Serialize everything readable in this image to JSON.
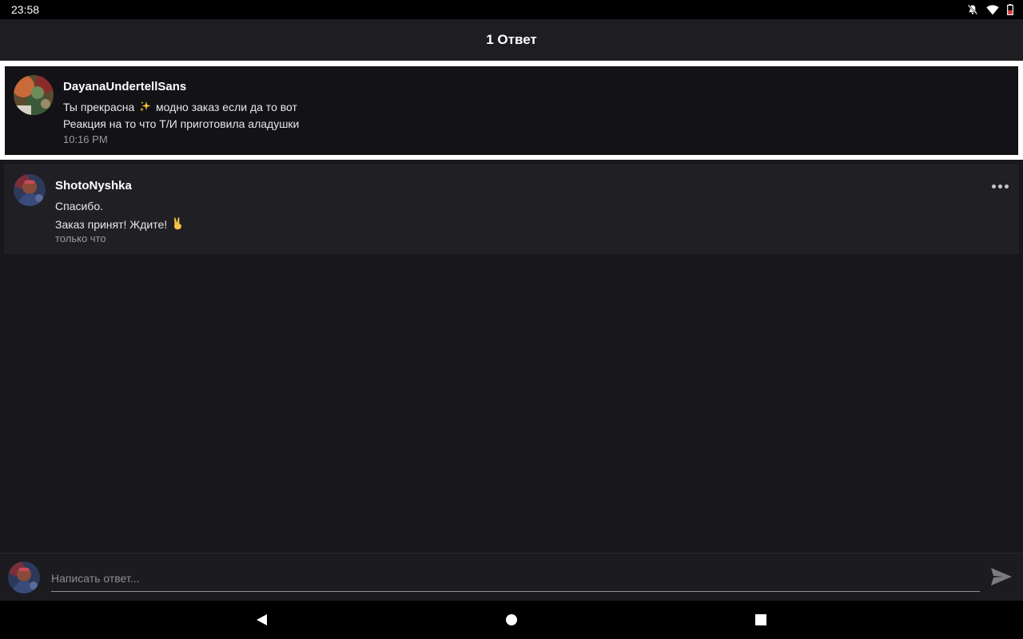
{
  "status_bar": {
    "time": "23:58",
    "icons": [
      "notifications-off-icon",
      "wifi-icon",
      "battery-low-icon"
    ]
  },
  "header": {
    "title": "1 Ответ"
  },
  "parent_comment": {
    "author": "DayanaUndertellSans",
    "line1_before": "Ты прекрасна",
    "line1_emoji": "sparkles-icon",
    "line1_after": "модно заказ если да то вот",
    "line2": "Реакция на то что Т/И приготовила аладушки",
    "time": "10:16 PM",
    "highlight_color": "#ffffff"
  },
  "reply_comment": {
    "author": "ShotoNyshka",
    "line1": "Спасибо.",
    "line2": "Заказ принят! Ждите!",
    "line2_emoji": "victory-hand-icon",
    "time": "только что",
    "more_icon": "more-horizontal-icon"
  },
  "composer": {
    "placeholder": "Написать ответ...",
    "send_icon": "send-icon"
  },
  "nav_bar": {
    "icons": [
      "back-icon",
      "home-icon",
      "recents-icon"
    ]
  }
}
